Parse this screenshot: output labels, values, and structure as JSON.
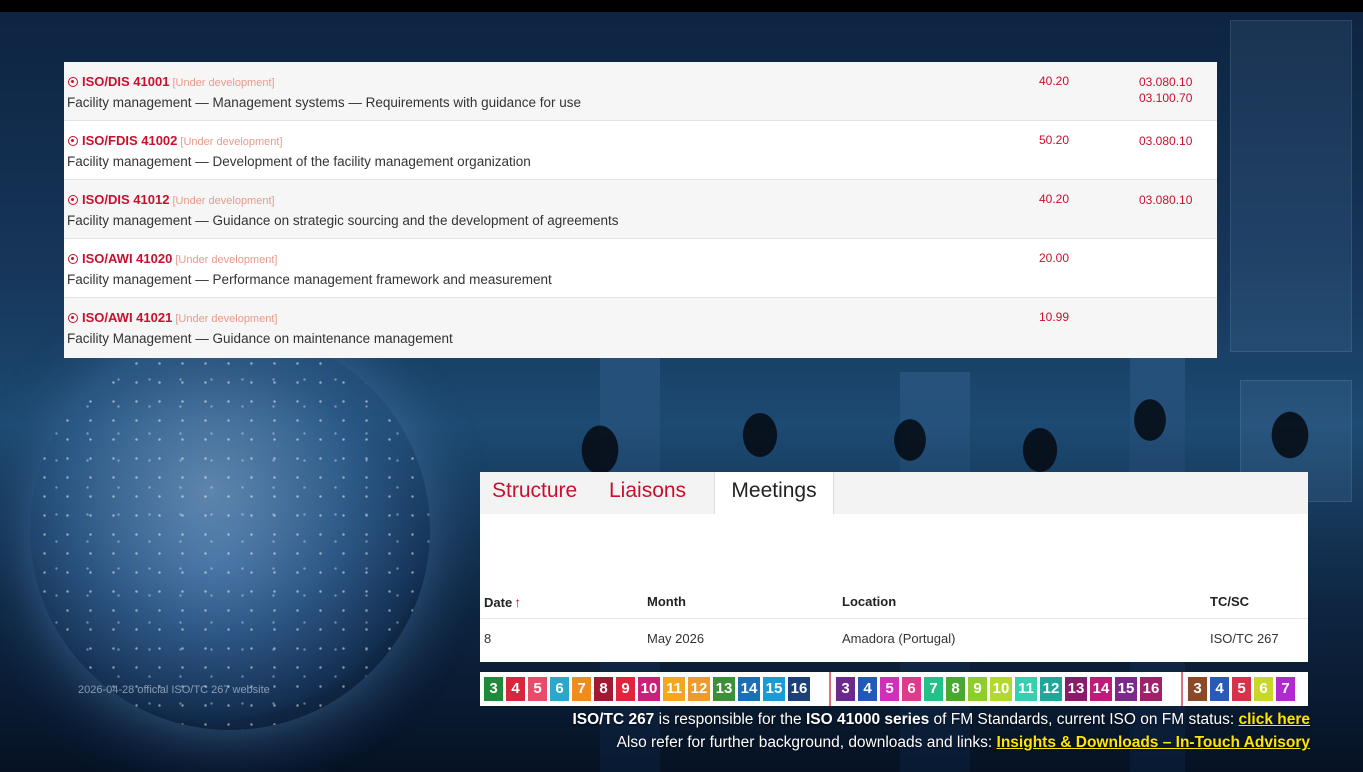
{
  "projects": [
    {
      "code": "ISO/DIS 41001",
      "status": "[Under development]",
      "title": "Facility management — Management systems — Requirements with guidance for use",
      "stage": "40.20",
      "ics": [
        "03.080.10",
        "03.100.70"
      ]
    },
    {
      "code": "ISO/FDIS 41002",
      "status": "[Under development]",
      "title": "Facility management — Development of the facility management organization",
      "stage": "50.20",
      "ics": [
        "03.080.10"
      ]
    },
    {
      "code": "ISO/DIS 41012",
      "status": "[Under development]",
      "title": "Facility management — Guidance on strategic sourcing and the development of agreements",
      "stage": "40.20",
      "ics": [
        "03.080.10"
      ]
    },
    {
      "code": "ISO/AWI 41020",
      "status": "[Under development]",
      "title": "Facility management — Performance management framework and measurement",
      "stage": "20.00",
      "ics": []
    },
    {
      "code": "ISO/AWI 41021",
      "status": "[Under development]",
      "title": "Facility Management — Guidance on maintenance management",
      "stage": "10.99",
      "ics": []
    }
  ],
  "tabs": {
    "structure": "Structure",
    "liaisons": "Liaisons",
    "meetings": "Meetings"
  },
  "meetings_table": {
    "headers": {
      "date": "Date",
      "sort_icon": "↑",
      "month": "Month",
      "location": "Location",
      "tc": "TC/SC"
    },
    "row": {
      "date": "8",
      "month": "May 2026",
      "location": "Amadora (Portugal)",
      "tc": "ISO/TC 267"
    }
  },
  "stage_strip": {
    "group1": [
      {
        "n": "3",
        "color": "#1f8a3a"
      },
      {
        "n": "4",
        "color": "#d7263d"
      },
      {
        "n": "5",
        "color": "#e84c6b"
      },
      {
        "n": "6",
        "color": "#2aa7c9"
      },
      {
        "n": "7",
        "color": "#f08b1d"
      },
      {
        "n": "8",
        "color": "#a01a34"
      },
      {
        "n": "9",
        "color": "#e3223c"
      },
      {
        "n": "10",
        "color": "#cc1f7a"
      },
      {
        "n": "11",
        "color": "#f2a81c"
      },
      {
        "n": "12",
        "color": "#f19a2a"
      },
      {
        "n": "13",
        "color": "#3d8f3a"
      },
      {
        "n": "14",
        "color": "#1c6fb3"
      },
      {
        "n": "15",
        "color": "#1a9bd6"
      },
      {
        "n": "16",
        "color": "#1d3f7a"
      }
    ],
    "group2": [
      {
        "n": "3",
        "color": "#6b2b8c"
      },
      {
        "n": "4",
        "color": "#2458b8"
      },
      {
        "n": "5",
        "color": "#d12fb8"
      },
      {
        "n": "6",
        "color": "#e03a8a"
      },
      {
        "n": "7",
        "color": "#24c08a"
      },
      {
        "n": "8",
        "color": "#4aa832"
      },
      {
        "n": "9",
        "color": "#8fce2a"
      },
      {
        "n": "10",
        "color": "#b3d92a"
      },
      {
        "n": "11",
        "color": "#35d0b0"
      },
      {
        "n": "12",
        "color": "#1ea89a"
      },
      {
        "n": "13",
        "color": "#8a1a6a"
      },
      {
        "n": "14",
        "color": "#c01a7a"
      },
      {
        "n": "15",
        "color": "#7a2a8a"
      },
      {
        "n": "16",
        "color": "#a0206a"
      }
    ],
    "group3": [
      {
        "n": "3",
        "color": "#8a4a2a"
      },
      {
        "n": "4",
        "color": "#2a5ab8"
      },
      {
        "n": "5",
        "color": "#d8324a"
      },
      {
        "n": "6",
        "color": "#c8d82a"
      },
      {
        "n": "7",
        "color": "#b02ad0"
      }
    ]
  },
  "slide": {
    "date_caption": "2026-04-28 official ISO/TC 267 website",
    "line1_bold1": "ISO/TC 267",
    "line1_text1": " is responsible for the ",
    "line1_bold2": "ISO 41000 series",
    "line1_text2": " of FM Standards, current ISO on FM status: ",
    "line1_link": "click here",
    "line2_text": "Also refer for further background, downloads and links: ",
    "line2_link": "Insights & Downloads – In-Touch Advisory"
  }
}
